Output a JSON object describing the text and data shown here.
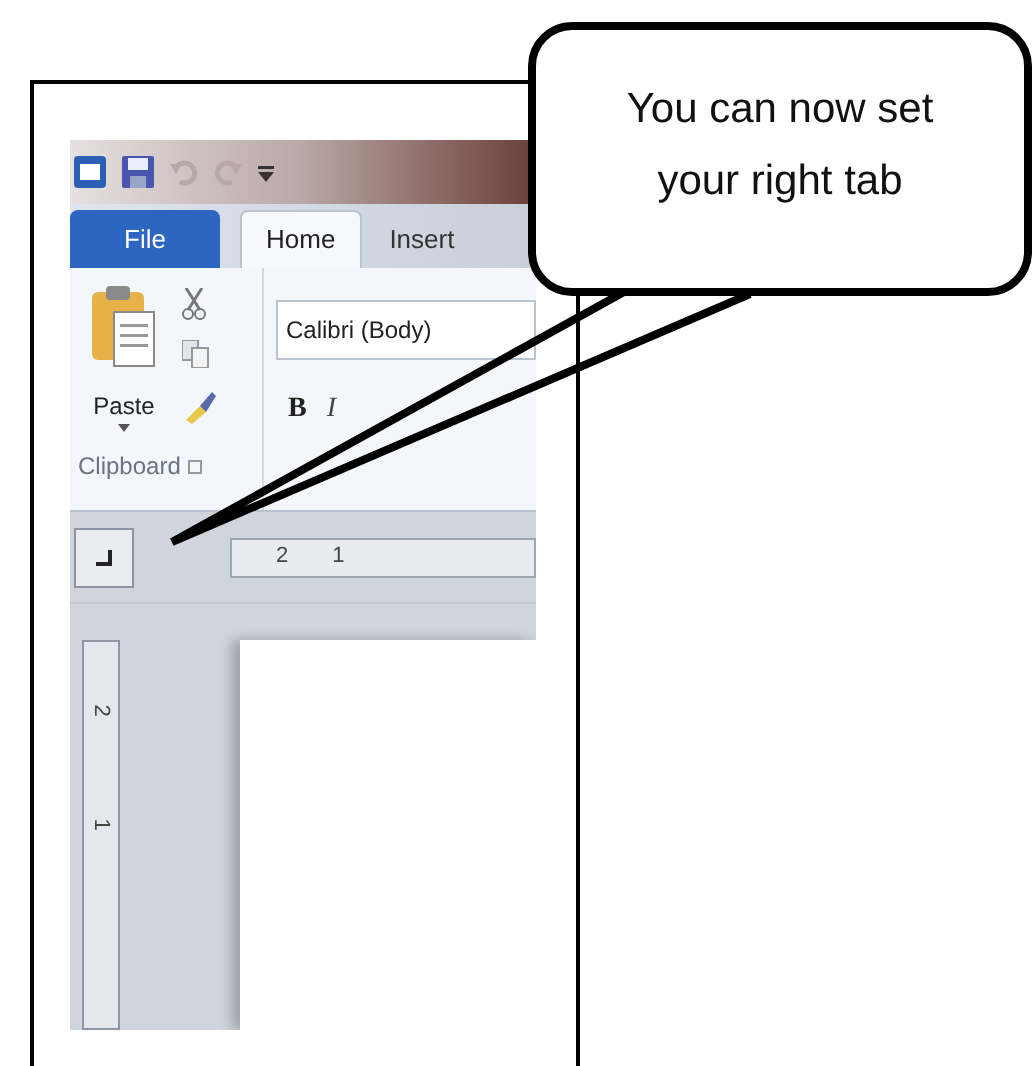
{
  "callout": {
    "text": "You can now set your right tab"
  },
  "tabs": [
    {
      "label": "File",
      "kind": "file",
      "selected": false
    },
    {
      "label": "Home",
      "kind": "tab",
      "selected": true
    },
    {
      "label": "Insert",
      "kind": "tab",
      "selected": false
    }
  ],
  "clipboard": {
    "paste": "Paste",
    "group_label": "Clipboard"
  },
  "font": {
    "value": "Calibri (Body)",
    "format_buttons": [
      "B",
      "I"
    ]
  },
  "horizontal_ruler": [
    "2",
    "1"
  ],
  "vertical_ruler": [
    "2",
    "1"
  ]
}
